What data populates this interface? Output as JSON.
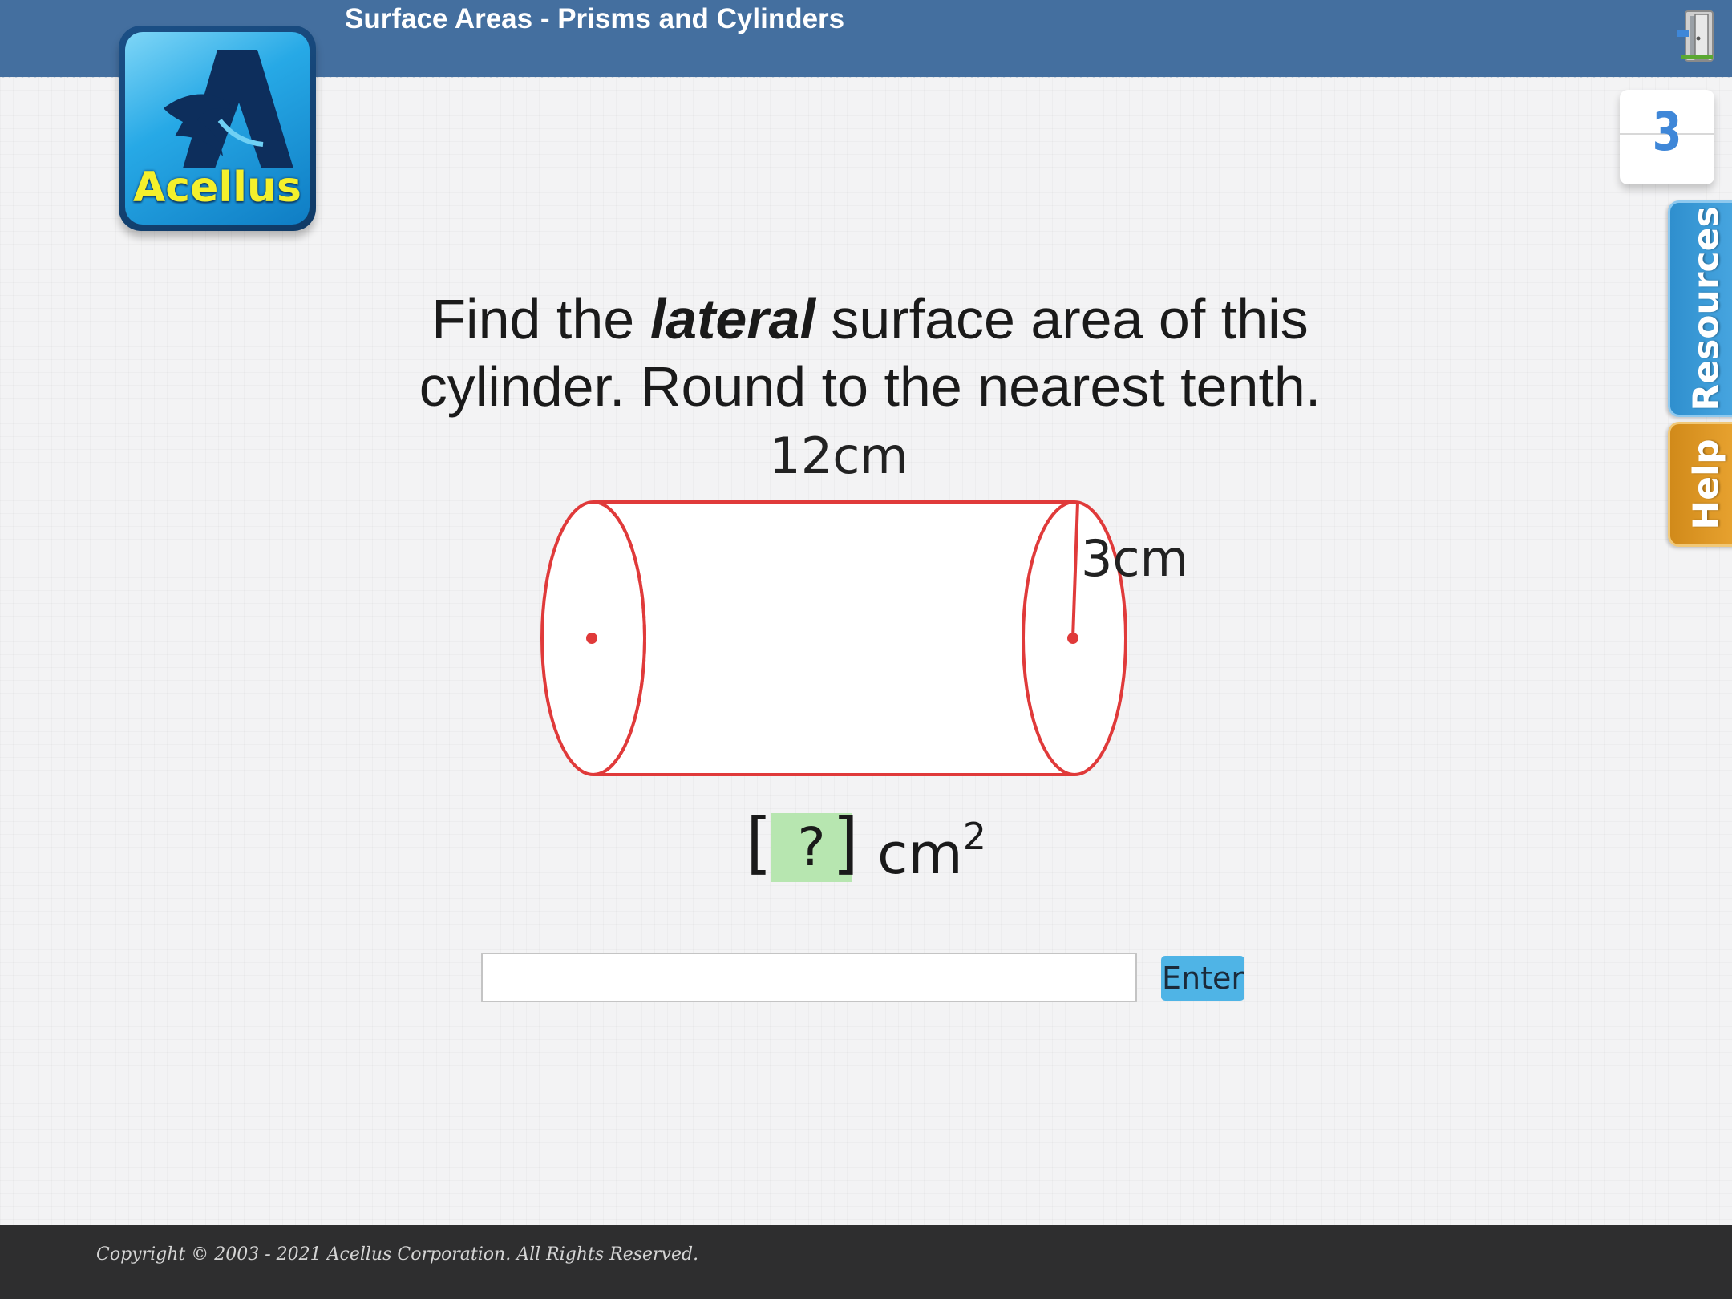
{
  "header": {
    "title": "Surface Areas - Prisms and Cylinders",
    "exit_icon": "door-exit-icon"
  },
  "logo": {
    "text": "Acellus"
  },
  "score": {
    "value": "3"
  },
  "side_tabs": {
    "resources": "Resources",
    "help": "Help"
  },
  "question": {
    "part1": "Find the ",
    "emphasis": "lateral",
    "part2": " surface area of this cylinder. Round to the nearest tenth."
  },
  "figure": {
    "shape": "cylinder",
    "length_label": "12cm",
    "radius_label": "3cm",
    "line_color": "#e03a3a"
  },
  "answer_template": {
    "placeholder_mark": "?",
    "unit": "cm",
    "exponent": "2",
    "blank_color": "#b7e6b0"
  },
  "answer_input": {
    "value": "",
    "placeholder": ""
  },
  "enter_button": {
    "label": "Enter"
  },
  "footer": {
    "copyright": "Copyright © 2003 - 2021 Acellus Corporation.  All Rights Reserved."
  },
  "colors": {
    "header_bg": "#446f9f",
    "footer_bg": "#2e2e2f",
    "enter_button": "#4fb4e6",
    "resources_tab": "#3a9bd9",
    "help_tab": "#e09a28",
    "score_text": "#3f87d8"
  }
}
